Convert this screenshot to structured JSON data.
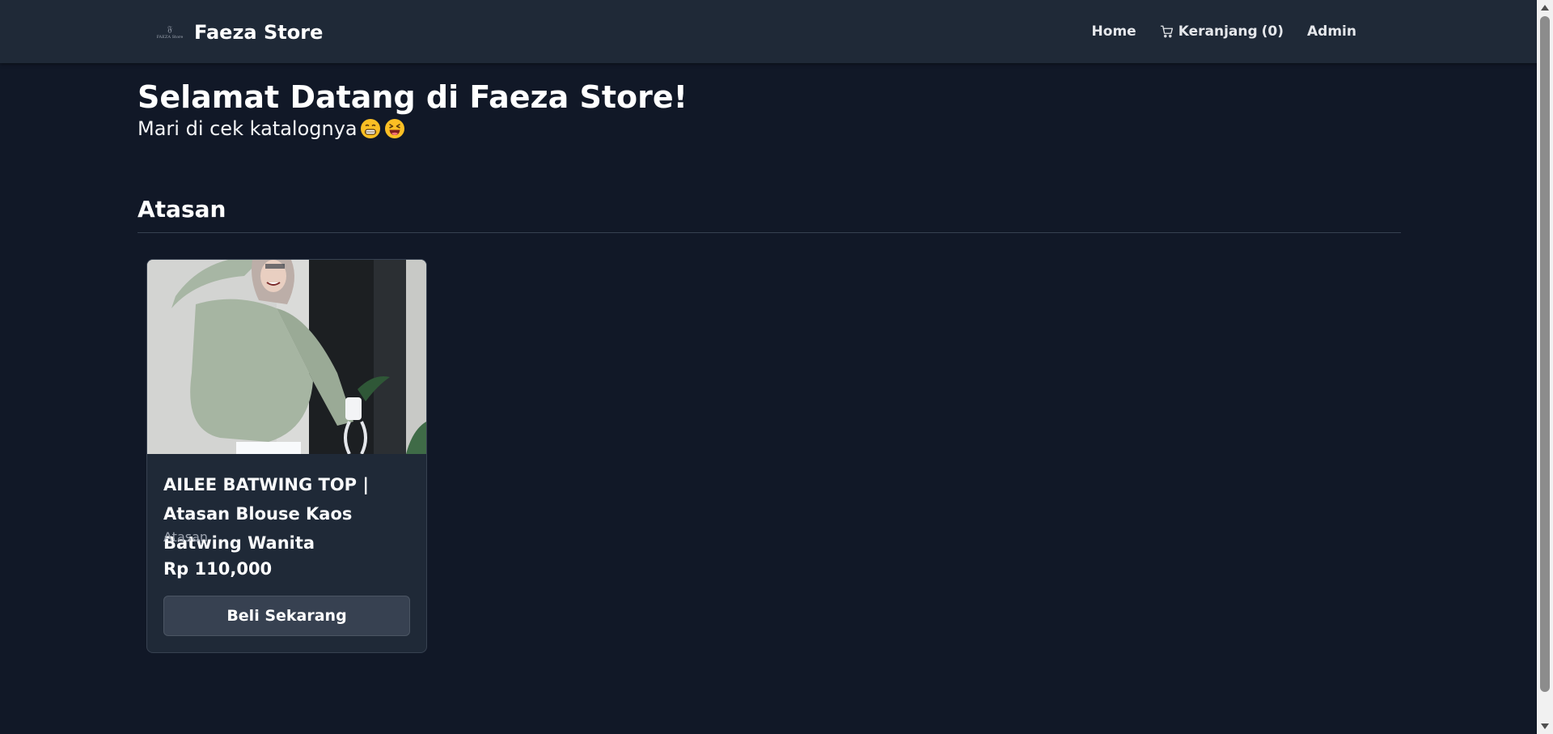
{
  "navbar": {
    "logo_text": "FAEZA Store",
    "brand_name": "Faeza Store",
    "links": {
      "home": "Home",
      "cart": "Keranjang",
      "cart_count": "(0)",
      "admin": "Admin"
    }
  },
  "hero": {
    "title": "Selamat Datang di Faeza Store!",
    "subtitle": "Mari di cek katalognya",
    "emojis": [
      "grinning-face-emoji",
      "squinting-laughing-face-emoji"
    ]
  },
  "section": {
    "title": "Atasan"
  },
  "products": [
    {
      "name": "AILEE BATWING TOP | Atasan Blouse Kaos Batwing Wanita",
      "category": "Atasan",
      "price": "Rp 110,000",
      "button_label": "Beli Sekarang"
    }
  ],
  "colors": {
    "background": "#111827",
    "navbar": "#1f2937",
    "card": "#1f2937",
    "button": "#374151",
    "muted_text": "#9ca3af"
  }
}
